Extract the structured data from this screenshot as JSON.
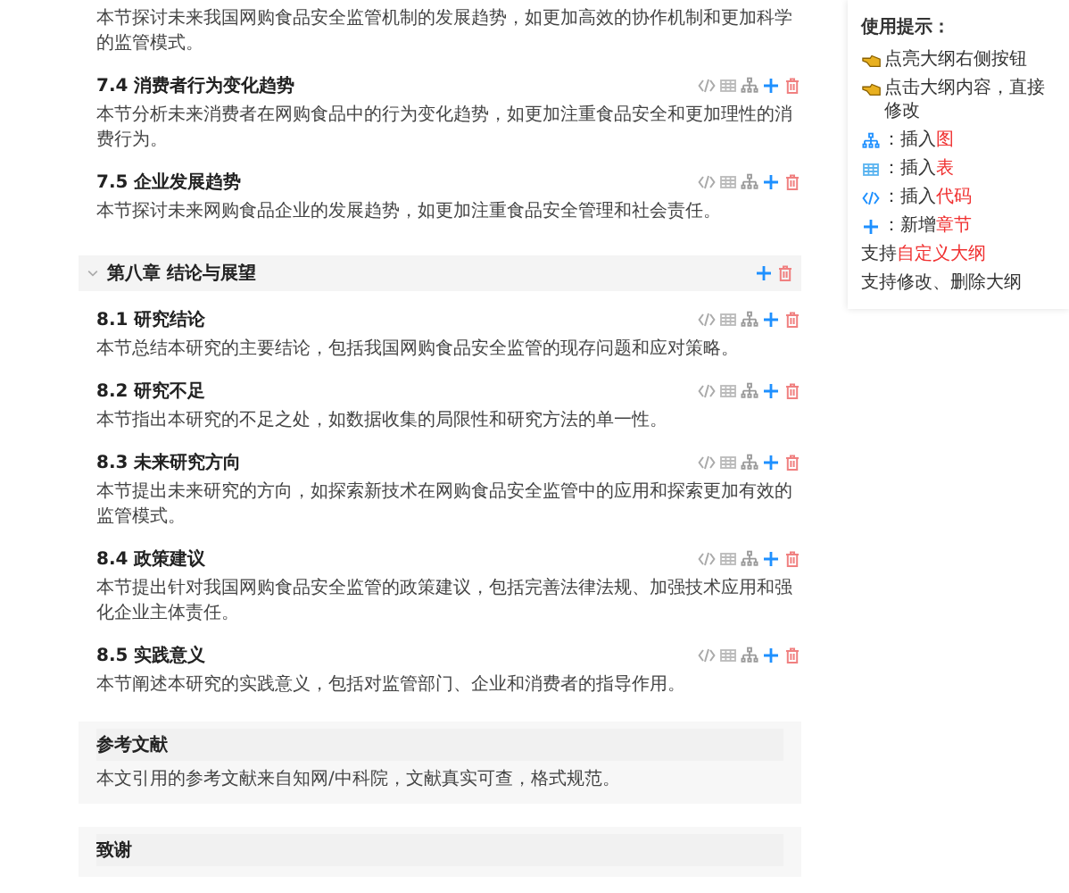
{
  "outline": [
    {
      "kind": "text",
      "body": "本节探讨未来我国网购食品安全监管机制的发展趋势，如更加高效的协作机制和更加科学的监管模式。"
    },
    {
      "kind": "section",
      "title": "7.4 消费者行为变化趋势",
      "body": "本节分析未来消费者在网购食品中的行为变化趋势，如更加注重食品安全和更加理性的消费行为。"
    },
    {
      "kind": "section",
      "title": "7.5 企业发展趋势",
      "body": "本节探讨未来网购食品企业的发展趋势，如更加注重食品安全管理和社会责任。"
    },
    {
      "kind": "chapter",
      "title": "第八章 结论与展望",
      "expanded": true
    },
    {
      "kind": "section",
      "title": "8.1 研究结论",
      "body": "本节总结本研究的主要结论，包括我国网购食品安全监管的现存问题和应对策略。"
    },
    {
      "kind": "section",
      "title": "8.2 研究不足",
      "body": "本节指出本研究的不足之处，如数据收集的局限性和研究方法的单一性。"
    },
    {
      "kind": "section",
      "title": "8.3 未来研究方向",
      "body": "本节提出未来研究的方向，如探索新技术在网购食品安全监管中的应用和探索更加有效的监管模式。"
    },
    {
      "kind": "section",
      "title": "8.4 政策建议",
      "body": "本节提出针对我国网购食品安全监管的政策建议，包括完善法律法规、加强技术应用和强化企业主体责任。"
    },
    {
      "kind": "section",
      "title": "8.5 实践意义",
      "body": "本节阐述本研究的实践意义，包括对监管部门、企业和消费者的指导作用。"
    },
    {
      "kind": "block",
      "title": "参考文献",
      "body": "本文引用的参考文献来自知网/中科院，文献真实可查，格式规范。"
    },
    {
      "kind": "block",
      "title": "致谢"
    }
  ],
  "tips": {
    "title": "使用提示：",
    "items": [
      {
        "kind": "hand",
        "text": "点亮大纲右侧按钮"
      },
      {
        "kind": "hand",
        "text": "点击大纲内容，直接修改"
      },
      {
        "kind": "tree",
        "text": "：插入",
        "highlight": "图"
      },
      {
        "kind": "table",
        "text": "：插入",
        "highlight": "表"
      },
      {
        "kind": "code",
        "text": "：插入",
        "highlight": "代码"
      },
      {
        "kind": "add",
        "text": "：新增",
        "highlight": "章节"
      },
      {
        "kind": "plain",
        "text": "支持",
        "highlight": "自定义大纲"
      },
      {
        "kind": "plain",
        "text": "支持修改、删除大纲"
      }
    ]
  }
}
